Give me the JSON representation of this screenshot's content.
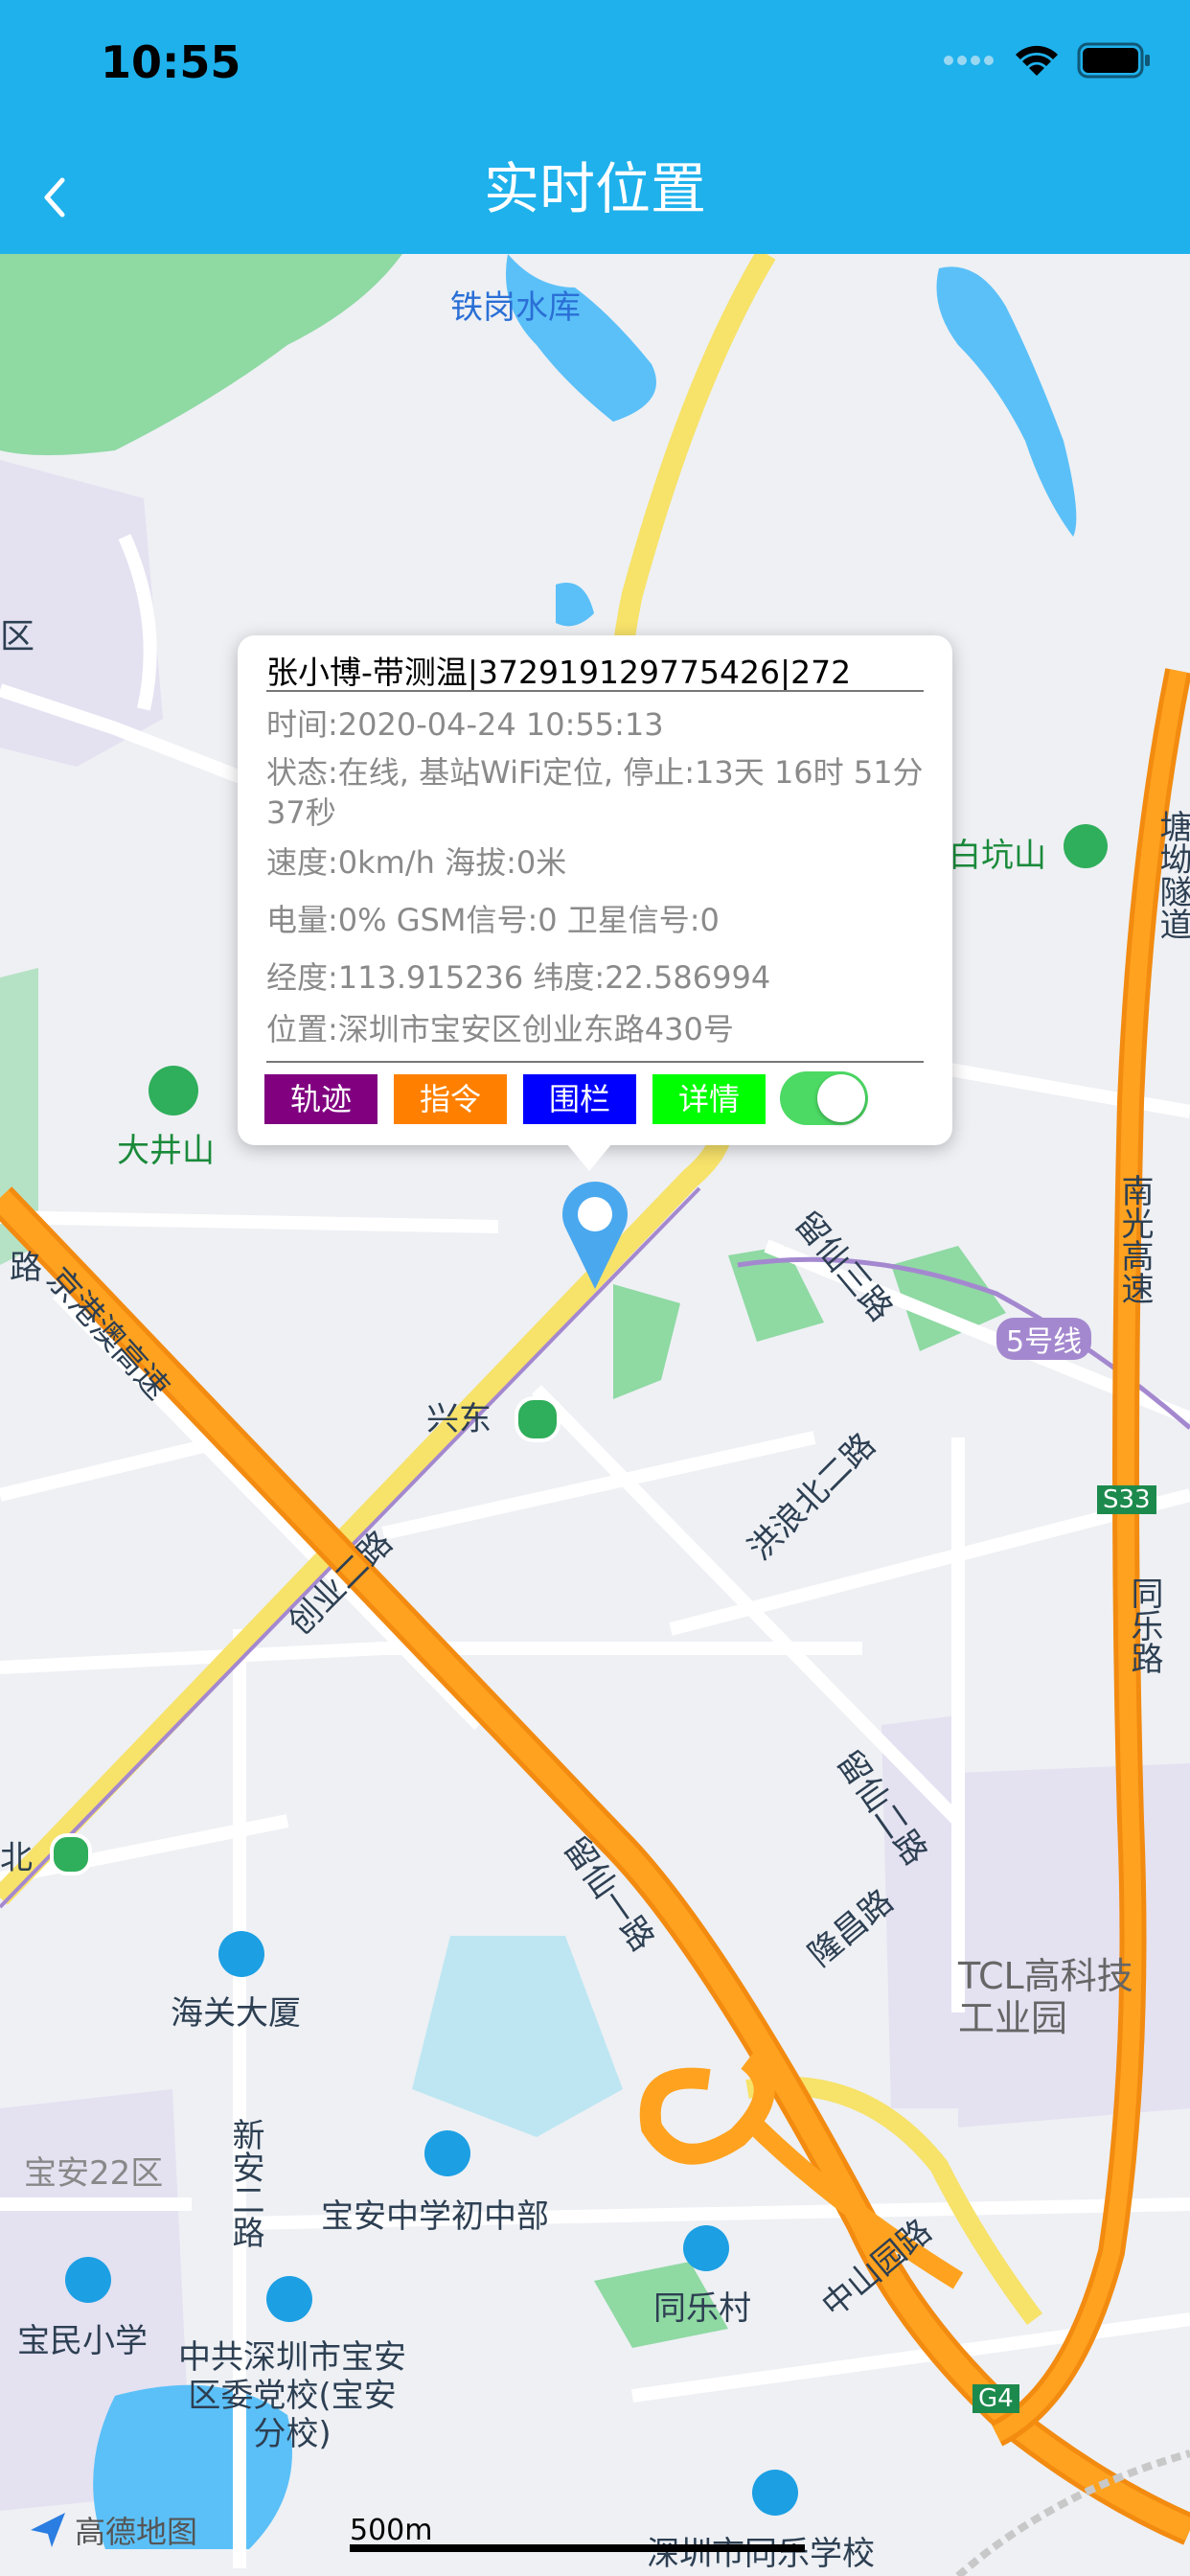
{
  "status_bar": {
    "time": "10:55"
  },
  "nav": {
    "title": "实时位置"
  },
  "popup": {
    "title": "张小博-带测温|372919129775426|272",
    "time": "时间:2020-04-24 10:55:13",
    "status": "状态:在线, 基站WiFi定位, 停止:13天 16时 51分 37秒",
    "speed": "速度:0km/h  海拔:0米",
    "battery": "电量:0% GSM信号:0 卫星信号:0",
    "coords": "经度:113.915236 纬度:22.586994",
    "address": "位置:深圳市宝安区创业东路430号",
    "buttons": [
      {
        "label": "轨迹",
        "color": "#800080"
      },
      {
        "label": "指令",
        "color": "#ff8000"
      },
      {
        "label": "围栏",
        "color": "#0000ff"
      },
      {
        "label": "详情",
        "color": "#00ff00"
      }
    ],
    "toggle_on": true
  },
  "map": {
    "labels": {
      "reservoir": "铁岗水库",
      "district_left": "区",
      "baikengshan": "白坑山",
      "dajingshan": "大井山",
      "tanglang_tunnel": "塘坳隧道",
      "nanguang": "南光高速",
      "line5": "5号线",
      "liuxian3": "留仙三路",
      "xingdong": "兴东",
      "honglang": "洪浪北二路",
      "jinggang": "京港澳高速",
      "lu_left": "路",
      "s33": "S33",
      "tongle_road": "同乐路",
      "chuangye2": "创业二路",
      "liuxian2": "留仙二路",
      "bei": "北",
      "liuxian1": "留仙一路",
      "longchang": "隆昌路",
      "haiguan": "海关大厦",
      "tcl": "TCL高科技工业园",
      "baoan22": "宝安22区",
      "xinan2": "新安二路",
      "baoan_middle": "宝安中学初中部",
      "tongle_village": "同乐村",
      "zhongshan": "中山园路",
      "baomin": "宝民小学",
      "party_school": "中共深圳市宝安区委党校(宝安分校)",
      "g4": "G4",
      "tongle_school": "深圳市同乐学校"
    },
    "logo": "高德地图",
    "scale": "500m"
  }
}
